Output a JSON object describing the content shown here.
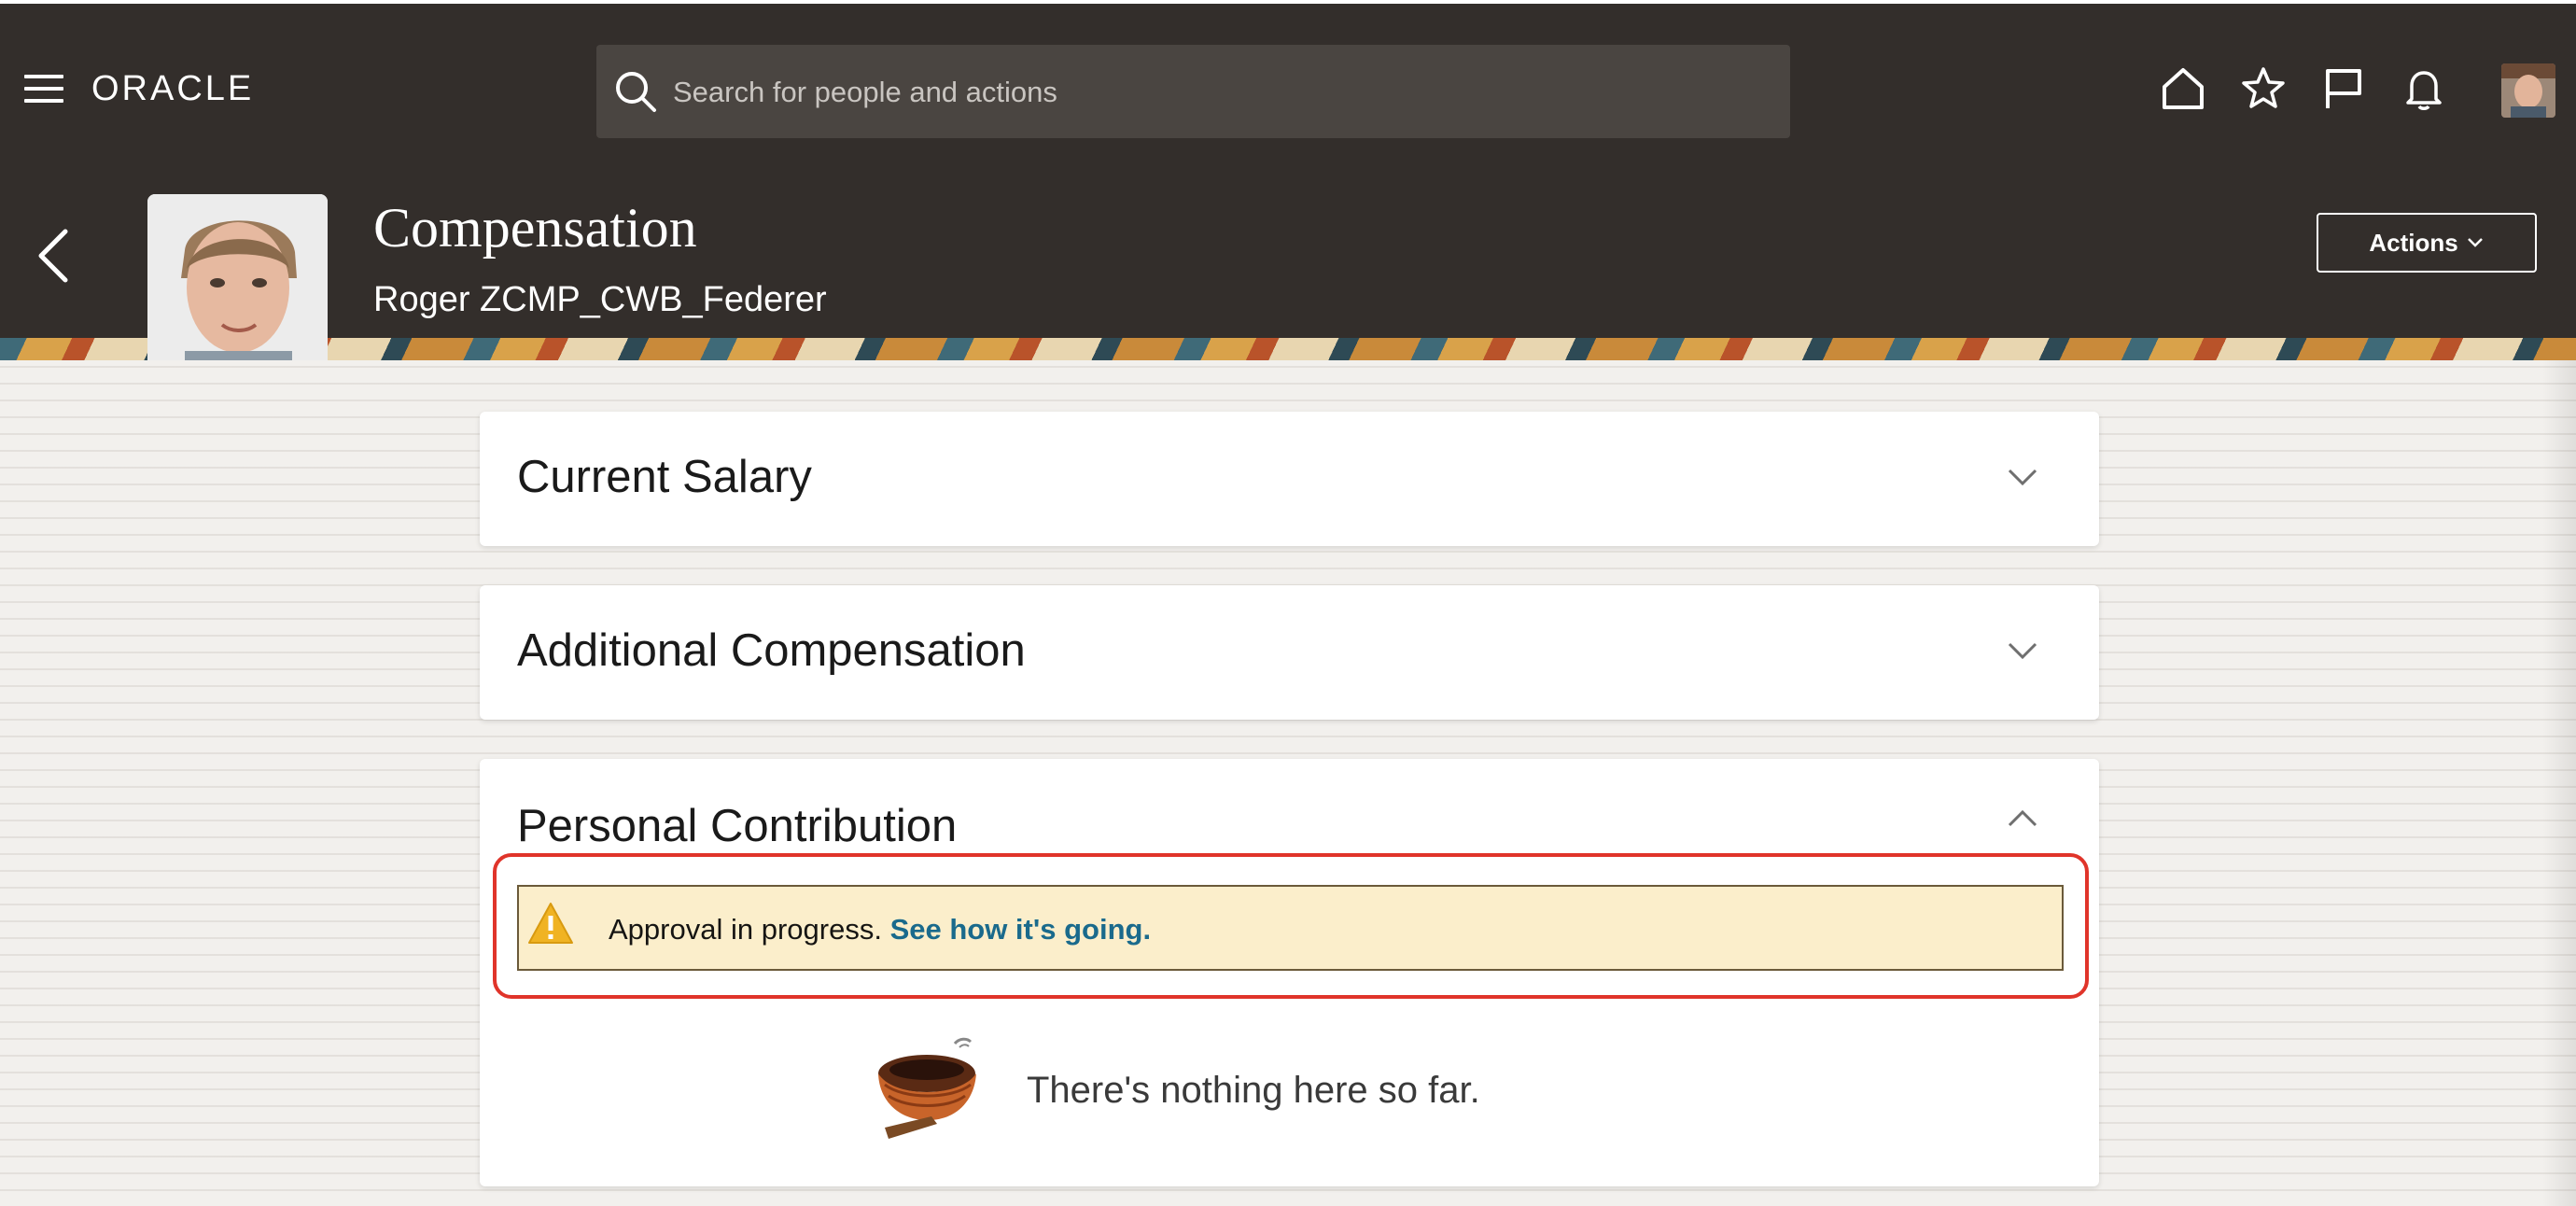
{
  "header": {
    "brand": "ORACLE",
    "search": {
      "placeholder": "Search for people and actions",
      "value": ""
    },
    "icons": [
      "hamburger-menu-icon",
      "home-icon",
      "star-icon",
      "flag-icon",
      "bell-icon",
      "user-avatar"
    ]
  },
  "page": {
    "title": "Compensation",
    "subtitle": "Roger ZCMP_CWB_Federer",
    "more_badge": "•••",
    "actions_label": "Actions"
  },
  "sections": [
    {
      "title": "Current Salary",
      "expanded": false
    },
    {
      "title": "Additional Compensation",
      "expanded": false
    },
    {
      "title": "Personal Contribution",
      "expanded": true
    }
  ],
  "alert": {
    "message": "Approval in progress.",
    "link": "See how it's going."
  },
  "empty_state": {
    "message": "There's nothing here so far."
  },
  "colors": {
    "header_bg": "#332e2b",
    "search_bg": "#4a4541",
    "alert_bg": "#fbeecb",
    "link": "#1a6a8c",
    "highlight": "#e0342a",
    "badge": "#b4651d"
  }
}
